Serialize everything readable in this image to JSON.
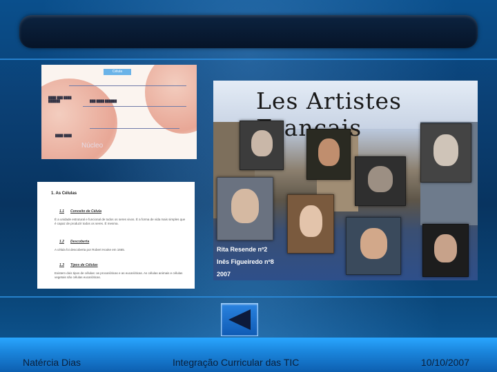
{
  "footer": {
    "author": "Natércia Dias",
    "title": "Integração Curricular das TIC",
    "date": "10/10/2007"
  },
  "cell_diagram": {
    "badge": "Célula",
    "nucleus_label": "Núcleo"
  },
  "document": {
    "heading": "1. As Células",
    "sections": [
      {
        "number": "1.1",
        "title": "Conceito de Célula",
        "text": "É a unidade estrutural e funcional de todos os seres vivos. É a forma de vida mais simples que é capaz de produzir todos os seres. É mesma."
      },
      {
        "number": "1.2",
        "title": "Descoberta",
        "text": "A célula foi descoberta por Robert Hooke em 1665."
      },
      {
        "number": "1.3",
        "title": "Tipos de Células",
        "text": "Existem dois tipos de células: as procarióticas e as eucarióticas. As células animais e células vegetais são células eucarióticas."
      }
    ]
  },
  "poster": {
    "title": "Les Artistes Français",
    "credits": [
      "Rita Resende nº2",
      "Inês Figueiredo nº8",
      "2007"
    ]
  },
  "nav": {
    "back_icon": "back-arrow-icon"
  },
  "colors": {
    "bottom_band": "#1b86dd",
    "background": "#0b3f73",
    "button": "#1a6fd0"
  }
}
